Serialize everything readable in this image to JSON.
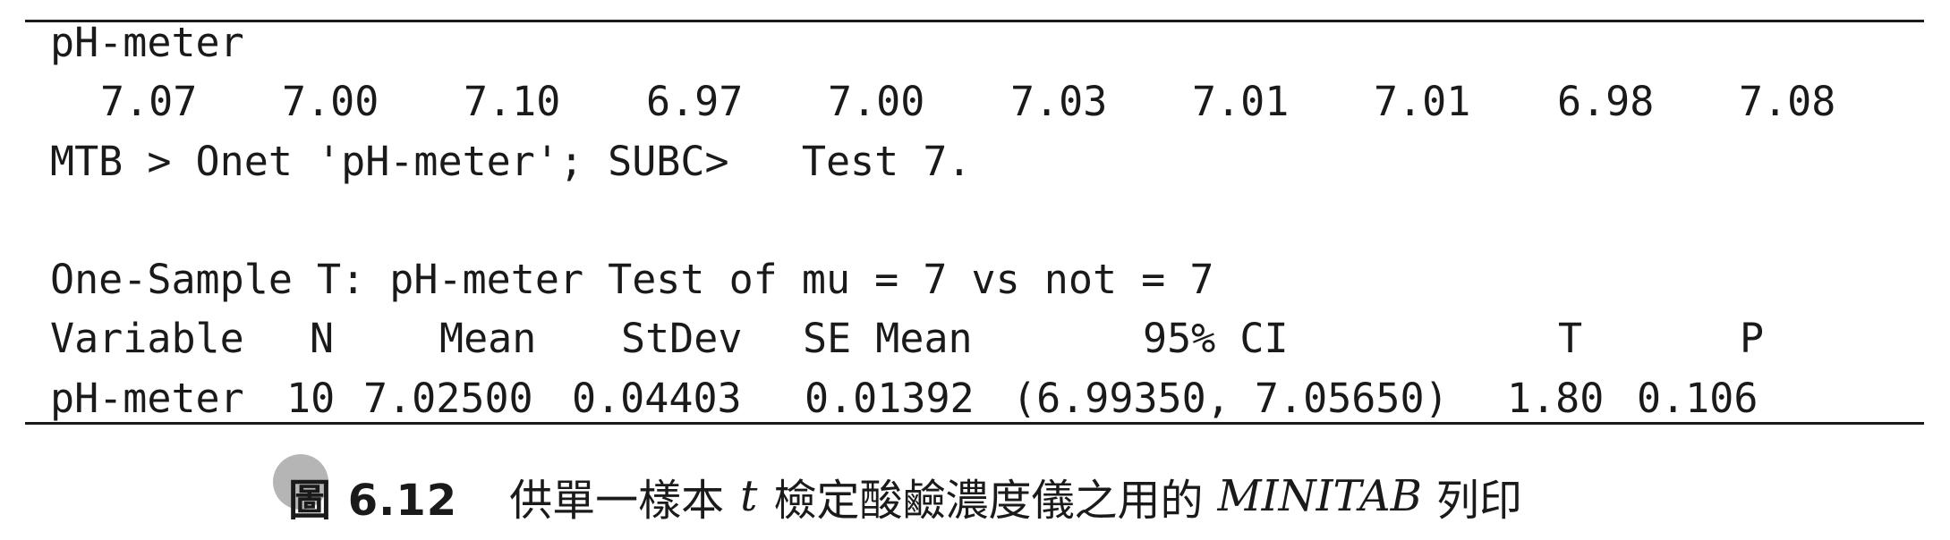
{
  "output": {
    "variable_name": "pH-meter",
    "values": [
      "7.07",
      "7.00",
      "7.10",
      "6.97",
      "7.00",
      "7.03",
      "7.01",
      "7.01",
      "6.98",
      "7.08"
    ],
    "command": "MTB > Onet 'pH-meter'; SUBC>   Test 7.",
    "test_heading": "One-Sample T: pH-meter Test of mu = 7 vs not = 7",
    "table": {
      "headers": [
        "Variable",
        "N",
        "Mean",
        "StDev",
        "SE Mean",
        "95% CI",
        "T",
        "P"
      ],
      "row": [
        "pH-meter",
        "10",
        "7.02500",
        "0.04403",
        "0.01392",
        "(6.99350, 7.05650)",
        "1.80",
        "0.106"
      ]
    }
  },
  "caption": {
    "label": "圖 6.12",
    "text_before": "供單一樣本",
    "t_symbol": "t",
    "text_middle": "檢定酸鹼濃度儀之用的",
    "software": "MINITAB",
    "text_after": "列印"
  }
}
